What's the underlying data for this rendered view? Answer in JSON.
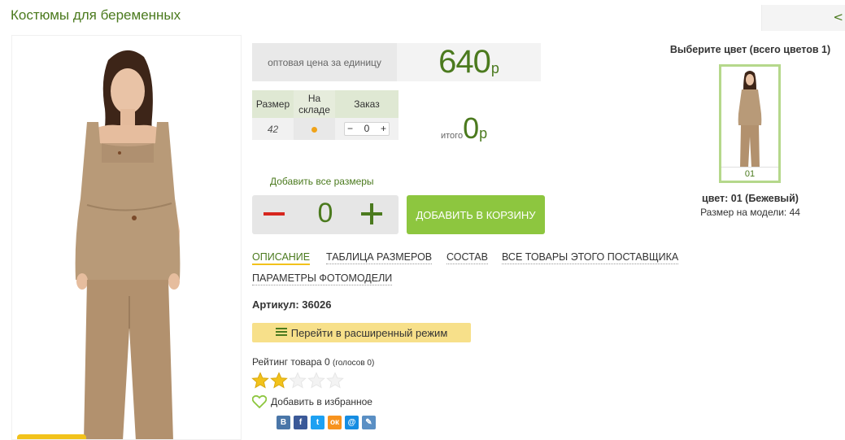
{
  "page": {
    "title": "Костюмы для беременных",
    "nav_arrow": "<"
  },
  "price": {
    "label": "оптовая цена за единицу",
    "value": "640",
    "currency": "р"
  },
  "size_table": {
    "headers": [
      "Размер",
      "На складе",
      "Заказ"
    ],
    "rows": [
      {
        "size": "42",
        "in_stock": true,
        "order_qty": "0"
      }
    ],
    "stepper_minus": "−",
    "stepper_plus": "+"
  },
  "total": {
    "label": "итого",
    "value": "0",
    "currency": "р"
  },
  "add_all": {
    "label": "Добавить все размеры",
    "qty": "0"
  },
  "cart_button": "ДОБАВИТЬ В КОРЗИНУ",
  "tabs": [
    {
      "label": "ОПИСАНИЕ",
      "active": true
    },
    {
      "label": "ТАБЛИЦА РАЗМЕРОВ",
      "active": false
    },
    {
      "label": "СОСТАВ",
      "active": false
    },
    {
      "label": "ВСЕ ТОВАРЫ ЭТОГО ПОСТАВЩИКА",
      "active": false
    },
    {
      "label": "ПАРАМЕТРЫ ФОТОМОДЕЛИ",
      "active": false
    }
  ],
  "article": "Артикул: 36026",
  "mode_button": "Перейти в расширенный режим",
  "rating": {
    "label": "Рейтинг товара 0",
    "votes": "(голосов 0)",
    "stars_filled": 2,
    "stars_total": 5
  },
  "favorite": "Добавить в избранное",
  "share": [
    {
      "name": "vk-icon",
      "glyph": "В",
      "color": "#4a76a8"
    },
    {
      "name": "facebook-icon",
      "glyph": "f",
      "color": "#3b5998"
    },
    {
      "name": "twitter-icon",
      "glyph": "t",
      "color": "#1da1f2"
    },
    {
      "name": "odnoklassniki-icon",
      "glyph": "ок",
      "color": "#f7931e"
    },
    {
      "name": "mailru-icon",
      "glyph": "@",
      "color": "#168de2"
    },
    {
      "name": "livejournal-icon",
      "glyph": "✎",
      "color": "#5a8fc4"
    }
  ],
  "color_picker": {
    "title": "Выберите цвет (всего цветов 1)",
    "swatch_code": "01",
    "color_name": "цвет: 01 (Бежевый)",
    "model_size": "Размер на модели: 44"
  },
  "colors": {
    "brand_green": "#4b7a1e",
    "button_green": "#8dc63f",
    "accent_yellow": "#f2c21b",
    "minus_red": "#d7261e",
    "product_beige": "#b89a78"
  }
}
